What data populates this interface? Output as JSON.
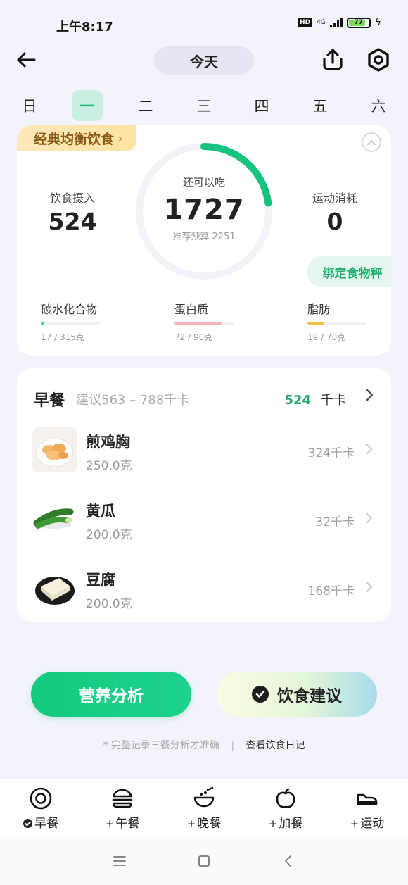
{
  "status_bar": {
    "time": "上午8:17",
    "hd": "HD",
    "network": "4G",
    "battery": "77",
    "battery_level": 0.77
  },
  "header": {
    "date_label": "今天",
    "icons": [
      "back-arrow-icon",
      "share-icon",
      "settings-icon"
    ]
  },
  "week": {
    "days": [
      "日",
      "一",
      "二",
      "三",
      "四",
      "五",
      "六"
    ],
    "active_index": 1
  },
  "summary": {
    "plan_name": "经典均衡饮食",
    "intake_label": "饮食摄入",
    "intake_value": "524",
    "remaining_label": "还可以吃",
    "remaining_value": "1727",
    "budget_text": "推荐预算 2251",
    "budget_progress": 0.23,
    "exercise_label": "运动消耗",
    "exercise_value": "0",
    "scale_button": "绑定食物秤",
    "macros": [
      {
        "name": "碳水化合物",
        "amount": "17 / 315克",
        "progress": 0.054,
        "color": "#3ecf8e"
      },
      {
        "name": "蛋白质",
        "amount": "72 / 90克",
        "progress": 0.8,
        "color": "#f7b3b3"
      },
      {
        "name": "脂肪",
        "amount": "19 / 70克",
        "progress": 0.27,
        "color": "#f5c04a"
      }
    ]
  },
  "meal": {
    "title": "早餐",
    "suggest": "建议563 – 788千卡",
    "kcal": "524",
    "kcal_unit": "千卡",
    "foods": [
      {
        "name": "煎鸡胸",
        "weight": "250.0克",
        "kcal": "324千卡",
        "icon": "fried-chicken-breast-image"
      },
      {
        "name": "黄瓜",
        "weight": "200.0克",
        "kcal": "32千卡",
        "icon": "cucumber-image"
      },
      {
        "name": "豆腐",
        "weight": "200.0克",
        "kcal": "168千卡",
        "icon": "tofu-image"
      }
    ]
  },
  "actions": {
    "analysis": "营养分析",
    "advice": "饮食建议",
    "hint": "* 完整记录三餐分析才准确",
    "separator": "|",
    "diary_link": "查看饮食日记"
  },
  "bottom_nav": [
    {
      "label": "早餐",
      "prefix": "",
      "checked": true,
      "icon": "breakfast-plate-icon"
    },
    {
      "label": "午餐",
      "prefix": "+",
      "checked": false,
      "icon": "burger-icon"
    },
    {
      "label": "晚餐",
      "prefix": "+",
      "checked": false,
      "icon": "rice-bowl-icon"
    },
    {
      "label": "加餐",
      "prefix": "+",
      "checked": false,
      "icon": "apple-icon"
    },
    {
      "label": "运动",
      "prefix": "+",
      "checked": false,
      "icon": "sneaker-icon"
    }
  ],
  "colors": {
    "accent": "#1fbf7a",
    "background": "#f3f3fb"
  }
}
